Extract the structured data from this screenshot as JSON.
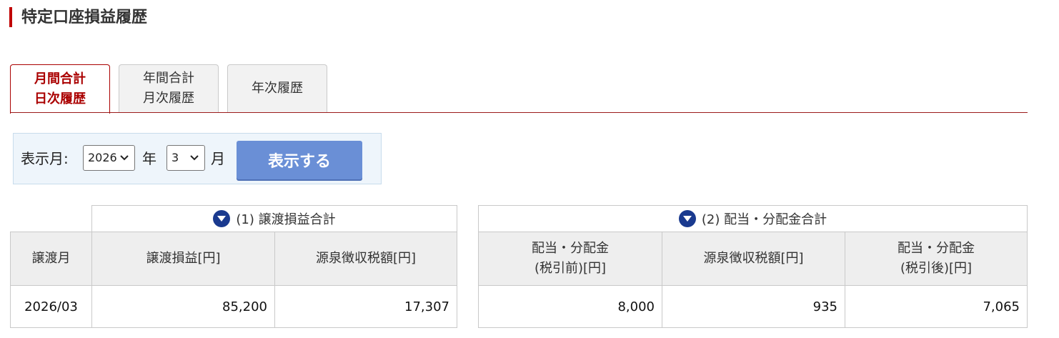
{
  "page": {
    "title": "特定口座損益履歴"
  },
  "tabs": [
    {
      "line1": "月間合計",
      "line2": "日次履歴"
    },
    {
      "line1": "年間合計",
      "line2": "月次履歴"
    },
    {
      "line1": "年次履歴",
      "line2": ""
    }
  ],
  "filter": {
    "label": "表示月:",
    "year_value": "2026",
    "year_unit": "年",
    "month_value": "3",
    "month_unit": "月",
    "button_label": "表示する"
  },
  "table1": {
    "group_title": "(1) 譲渡損益合計",
    "headers": {
      "month": "譲渡月",
      "pl": "譲渡損益[円]",
      "tax": "源泉徴収税額[円]"
    },
    "row": {
      "month": "2026/03",
      "pl": "85,200",
      "tax": "17,307"
    }
  },
  "table2": {
    "group_title": "(2) 配当・分配金合計",
    "headers": {
      "before_l1": "配当・分配金",
      "before_l2": "(税引前)[円]",
      "tax": "源泉徴収税額[円]",
      "after_l1": "配当・分配金",
      "after_l2": "(税引後)[円]"
    },
    "row": {
      "before": "8,000",
      "tax": "935",
      "after": "7,065"
    }
  },
  "icons": {
    "group_toggle": "triangle-down-icon",
    "select_chevron": "chevron-down-icon"
  },
  "colors": {
    "accent": "#a00000",
    "button": "#6a8fd6",
    "toggle": "#1a3a8f"
  }
}
